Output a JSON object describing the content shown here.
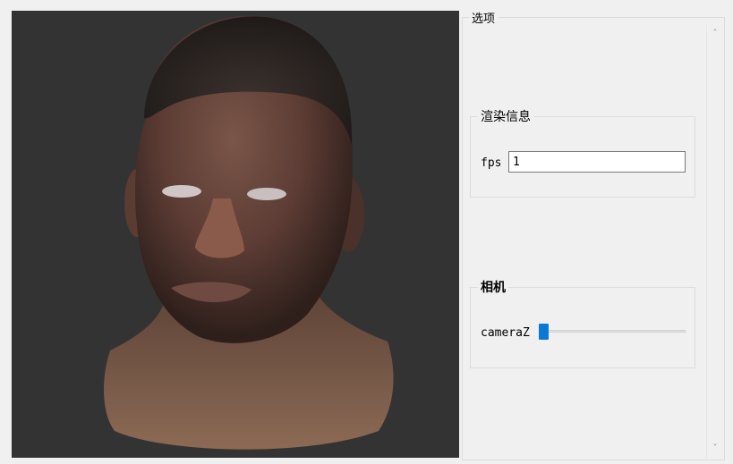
{
  "options": {
    "title": "选项"
  },
  "render_info": {
    "title": "渲染信息",
    "fps_label": "fps",
    "fps_value": "1"
  },
  "camera": {
    "title": "相机",
    "z_label": "cameraZ",
    "z_level": 0.0
  },
  "viewport": {
    "subject": "3D rendered head model",
    "background": "#333333"
  },
  "scrollbar": {
    "up_icon": "chevron-up-icon",
    "down_icon": "chevron-down-icon"
  },
  "colors": {
    "accent": "#0a78d7",
    "panel_bg": "#f0f0f0"
  }
}
